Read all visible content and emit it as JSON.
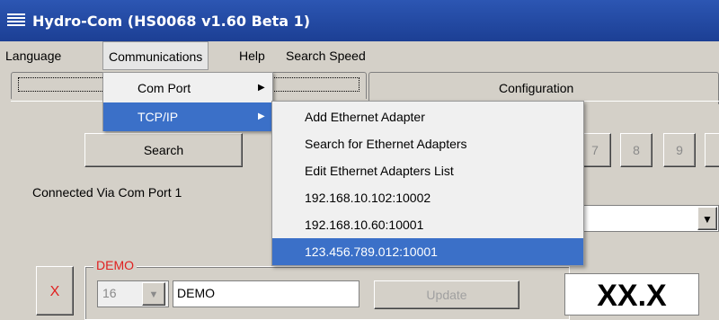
{
  "window": {
    "title": "Hydro-Com (HS0068 v1.60 Beta 1)"
  },
  "menubar": [
    "Language",
    "Communications",
    "Help",
    "Search Speed"
  ],
  "tabs": {
    "second": "Configuration"
  },
  "search_button": "Search",
  "number_buttons": [
    "7",
    "8",
    "9"
  ],
  "status": "Connected Via Com Port 1",
  "demo_group": {
    "label": "DEMO",
    "close_label": "X",
    "address": "16",
    "name": "DEMO",
    "update_label": "Update",
    "readout": "XX.X"
  },
  "communications_menu": [
    "Com Port",
    "TCP/IP"
  ],
  "tcpip_menu": [
    "Add Ethernet Adapter",
    "Search for Ethernet Adapters",
    "Edit Ethernet Adapters List",
    "192.168.10.102:10002",
    "192.168.10.60:10001",
    "123.456.789.012:10001"
  ],
  "colors": {
    "title_bar": "#1c3f94",
    "menu_highlight": "#3b70c8",
    "accent_red": "#e02020"
  }
}
